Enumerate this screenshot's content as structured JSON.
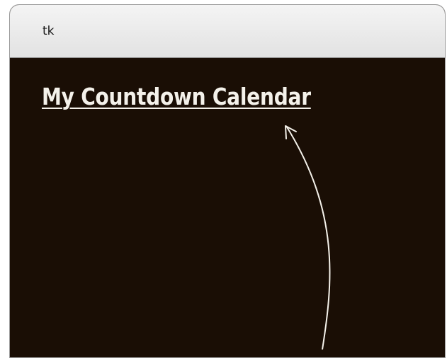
{
  "window": {
    "title": "tk"
  },
  "page": {
    "heading": "My Countdown Calendar"
  }
}
